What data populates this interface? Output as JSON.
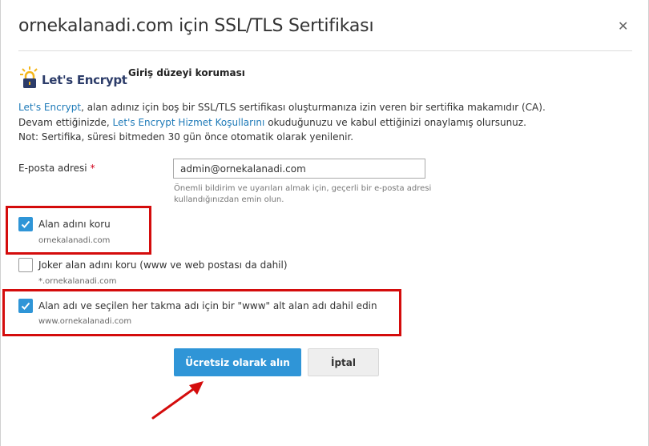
{
  "dialog": {
    "title": "ornekalanadi.com için SSL/TLS Sertifikası",
    "close_icon": "close-icon",
    "close_glyph": "✕"
  },
  "provider": {
    "logo_text": "Let's Encrypt",
    "level": "Giriş düzeyi koruması"
  },
  "description": {
    "line1_link": "Let's Encrypt",
    "line1_rest": ", alan adınız için boş bir SSL/TLS sertifikası oluşturmanıza izin veren bir sertifika makamıdır (CA).",
    "line2_start": "Devam ettiğinizde, ",
    "line2_link": "Let's Encrypt Hizmet Koşullarını",
    "line2_rest": " okuduğunuzu ve kabul ettiğinizi onaylamış olursunuz.",
    "line3": "Not: Sertifika, süresi bitmeden 30 gün önce otomatik olarak yenilenir."
  },
  "email": {
    "label": "E-posta adresi",
    "required_mark": "*",
    "value": "admin@ornekalanadi.com",
    "hint_line1": "Önemli bildirim ve uyarıları almak için, geçerli bir e-posta adresi",
    "hint_line2": "kullandığınızdan emin olun."
  },
  "options": [
    {
      "label": "Alan adını koru",
      "sub": "ornekalanadi.com",
      "checked": true
    },
    {
      "label": "Joker alan adını koru (www ve web postası da dahil)",
      "sub": "*.ornekalanadi.com",
      "checked": false
    },
    {
      "label": "Alan adı ve seçilen her takma adı için bir \"www\" alt alan adı dahil edin",
      "sub": "www.ornekalanadi.com",
      "checked": true
    }
  ],
  "buttons": {
    "primary": "Ücretsiz olarak alın",
    "cancel": "İptal"
  },
  "colors": {
    "accent": "#2f95d7",
    "highlight": "#d40c0c",
    "link": "#1e7ab8",
    "logo": "#2c3c69",
    "logo_icon": "#f4b61a"
  }
}
